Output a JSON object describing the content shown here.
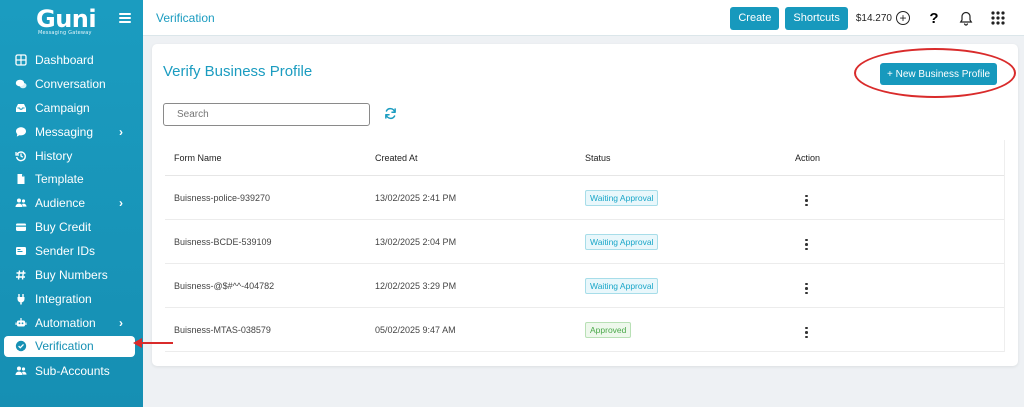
{
  "brand": {
    "logo_text": "Guni",
    "tagline": "Messaging Gateway"
  },
  "sidebar": {
    "items": [
      {
        "label": "Dashboard",
        "icon": "grid-icon",
        "active": false,
        "chevron": false
      },
      {
        "label": "Conversation",
        "icon": "chat-icon",
        "active": false,
        "chevron": false
      },
      {
        "label": "Campaign",
        "icon": "inbox-icon",
        "active": false,
        "chevron": false
      },
      {
        "label": "Messaging",
        "icon": "message-icon",
        "active": false,
        "chevron": true
      },
      {
        "label": "History",
        "icon": "history-icon",
        "active": false,
        "chevron": false
      },
      {
        "label": "Template",
        "icon": "document-icon",
        "active": false,
        "chevron": false
      },
      {
        "label": "Audience",
        "icon": "users-icon",
        "active": false,
        "chevron": true
      },
      {
        "label": "Buy Credit",
        "icon": "wallet-icon",
        "active": false,
        "chevron": false
      },
      {
        "label": "Sender IDs",
        "icon": "id-card-icon",
        "active": false,
        "chevron": false
      },
      {
        "label": "Buy Numbers",
        "icon": "hash-icon",
        "active": false,
        "chevron": false
      },
      {
        "label": "Integration",
        "icon": "plug-icon",
        "active": false,
        "chevron": false
      },
      {
        "label": "Automation",
        "icon": "robot-icon",
        "active": false,
        "chevron": true
      },
      {
        "label": "Verification",
        "icon": "check-circle-icon",
        "active": true,
        "chevron": false
      },
      {
        "label": "Sub-Accounts",
        "icon": "users-icon",
        "active": false,
        "chevron": false
      }
    ]
  },
  "topbar": {
    "title": "Verification",
    "create_label": "Create",
    "shortcuts_label": "Shortcuts",
    "balance": "$14.270",
    "help_glyph": "?"
  },
  "card": {
    "title": "Verify Business Profile",
    "new_button_label": "+ New Business Profile",
    "search_placeholder": "Search"
  },
  "table": {
    "headers": [
      "Form Name",
      "Created At",
      "Status",
      "Action"
    ],
    "rows": [
      {
        "name": "Buisness-police-939270",
        "created": "13/02/2025 2:41 PM",
        "status": "Waiting Approval",
        "status_type": "waiting"
      },
      {
        "name": "Buisness-BCDE-539109",
        "created": "13/02/2025 2:04 PM",
        "status": "Waiting Approval",
        "status_type": "waiting"
      },
      {
        "name": "Buisness-@$#^^-404782",
        "created": "12/02/2025 3:29 PM",
        "status": "Waiting Approval",
        "status_type": "waiting"
      },
      {
        "name": "Buisness-MTAS-038579",
        "created": "05/02/2025 9:47 AM",
        "status": "Approved",
        "status_type": "approved"
      }
    ]
  },
  "colors": {
    "brand": "#1b9cc0",
    "annotation": "#d92b2b",
    "waiting": "#1aa6c8",
    "approved": "#4aa84a"
  }
}
